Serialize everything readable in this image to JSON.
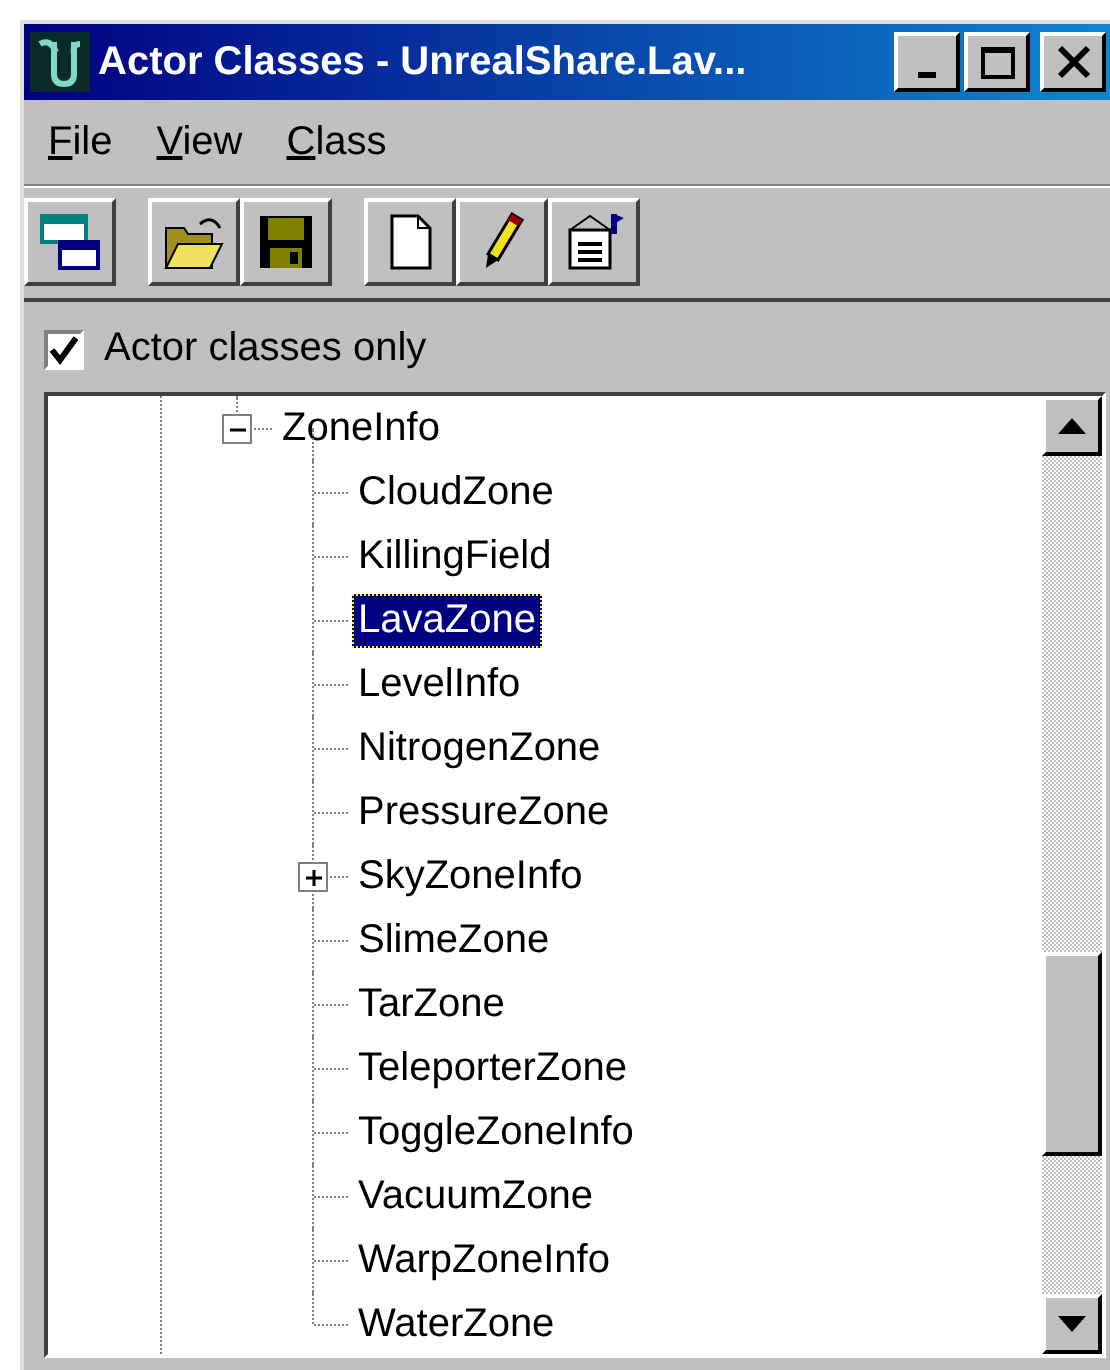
{
  "window": {
    "title": "Actor Classes - UnrealShare.Lav..."
  },
  "menu": [
    "File",
    "View",
    "Class"
  ],
  "filter": {
    "label": "Actor classes only",
    "checked": true
  },
  "tree": [
    {
      "label": "ZoneInfo",
      "selected": false,
      "expanded": true,
      "children": [
        {
          "label": "CloudZone",
          "selected": false
        },
        {
          "label": "KillingField",
          "selected": false
        },
        {
          "label": "LavaZone",
          "selected": true
        },
        {
          "label": "LevelInfo",
          "selected": false
        },
        {
          "label": "NitrogenZone",
          "selected": false
        },
        {
          "label": "PressureZone",
          "selected": false
        },
        {
          "label": "SkyZoneInfo",
          "selected": false,
          "expanded": false
        },
        {
          "label": "SlimeZone",
          "selected": false
        },
        {
          "label": "TarZone",
          "selected": false
        },
        {
          "label": "TeleporterZone",
          "selected": false
        },
        {
          "label": "ToggleZoneInfo",
          "selected": false
        },
        {
          "label": "VacuumZone",
          "selected": false
        },
        {
          "label": "WarpZoneInfo",
          "selected": false
        },
        {
          "label": "WaterZone",
          "selected": false
        }
      ]
    }
  ]
}
